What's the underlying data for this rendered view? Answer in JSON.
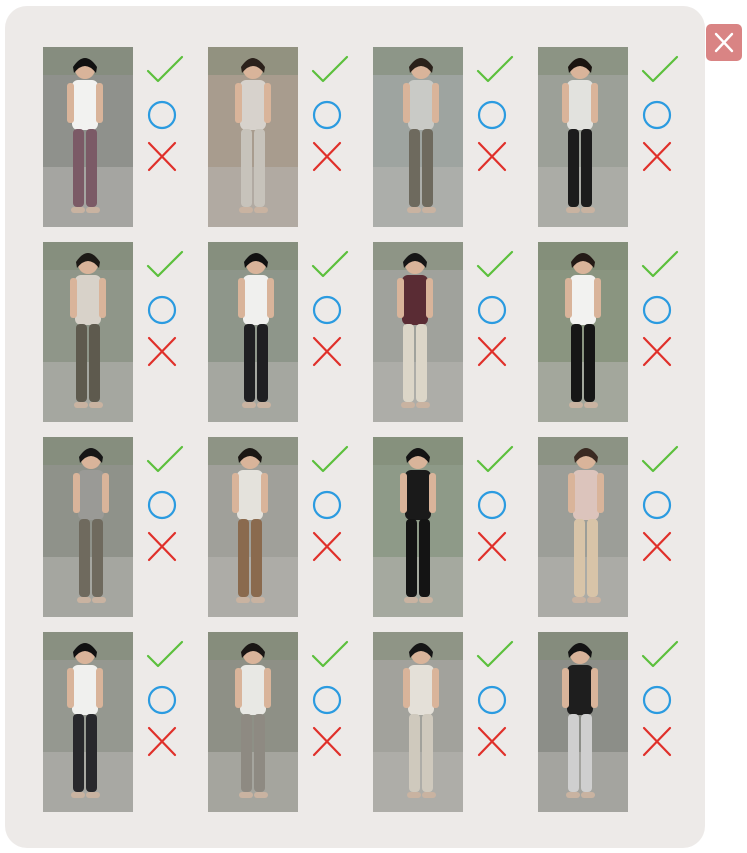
{
  "dialog": {
    "close_icon": "close-icon",
    "close_color": "#d98484"
  },
  "options": {
    "check_icon": "check-icon",
    "check_color": "#5cc03c",
    "circle_icon": "circle-icon",
    "circle_color": "#2b9be0",
    "cross_icon": "cross-icon",
    "cross_color": "#e0302a"
  },
  "grid": {
    "rows": 4,
    "columns": 4,
    "images": [
      {
        "bg": "#8f918c",
        "top": "#f2f2f0",
        "bottom": "#7b5a66",
        "hair": "#111111"
      },
      {
        "bg": "#a89c8e",
        "top": "#d7d2cc",
        "bottom": "#c7c3bb",
        "hair": "#2b211b"
      },
      {
        "bg": "#9ea4a0",
        "top": "#c9cac6",
        "bottom": "#6e6a5e",
        "hair": "#2a211a"
      },
      {
        "bg": "#9ca098",
        "top": "#e2e2de",
        "bottom": "#1c1c1c",
        "hair": "#1a1410"
      },
      {
        "bg": "#8f9689",
        "top": "#d8d2c9",
        "bottom": "#5e5a4e",
        "hair": "#1d1a16"
      },
      {
        "bg": "#8e968a",
        "top": "#f0f0ee",
        "bottom": "#1f1f22",
        "hair": "#111111"
      },
      {
        "bg": "#a0a29c",
        "top": "#5a2c34",
        "bottom": "#dcd6c8",
        "hair": "#161616"
      },
      {
        "bg": "#8a9580",
        "top": "#f2f2f0",
        "bottom": "#161616",
        "hair": "#241a16"
      },
      {
        "bg": "#8f928a",
        "top": "#9a9a96",
        "bottom": "#6f6a5e",
        "hair": "#161616"
      },
      {
        "bg": "#a0a09a",
        "top": "#e4e2dc",
        "bottom": "#8a6a4e",
        "hair": "#1b1714"
      },
      {
        "bg": "#8e9a88",
        "top": "#1a1a1a",
        "bottom": "#141414",
        "hair": "#141414"
      },
      {
        "bg": "#9c9e98",
        "top": "#dcc4bc",
        "bottom": "#d8c4a8",
        "hair": "#3a2a22"
      },
      {
        "bg": "#959890",
        "top": "#f0f0ee",
        "bottom": "#28282c",
        "hair": "#111111"
      },
      {
        "bg": "#8e9086",
        "top": "#e8e8e4",
        "bottom": "#8e8a82",
        "hair": "#1a1614"
      },
      {
        "bg": "#a2a29c",
        "top": "#e4e0d8",
        "bottom": "#cfc9bd",
        "hair": "#161616"
      },
      {
        "bg": "#8c8e88",
        "top": "#1e1e1e",
        "bottom": "#cfcfcf",
        "hair": "#141414"
      }
    ]
  }
}
